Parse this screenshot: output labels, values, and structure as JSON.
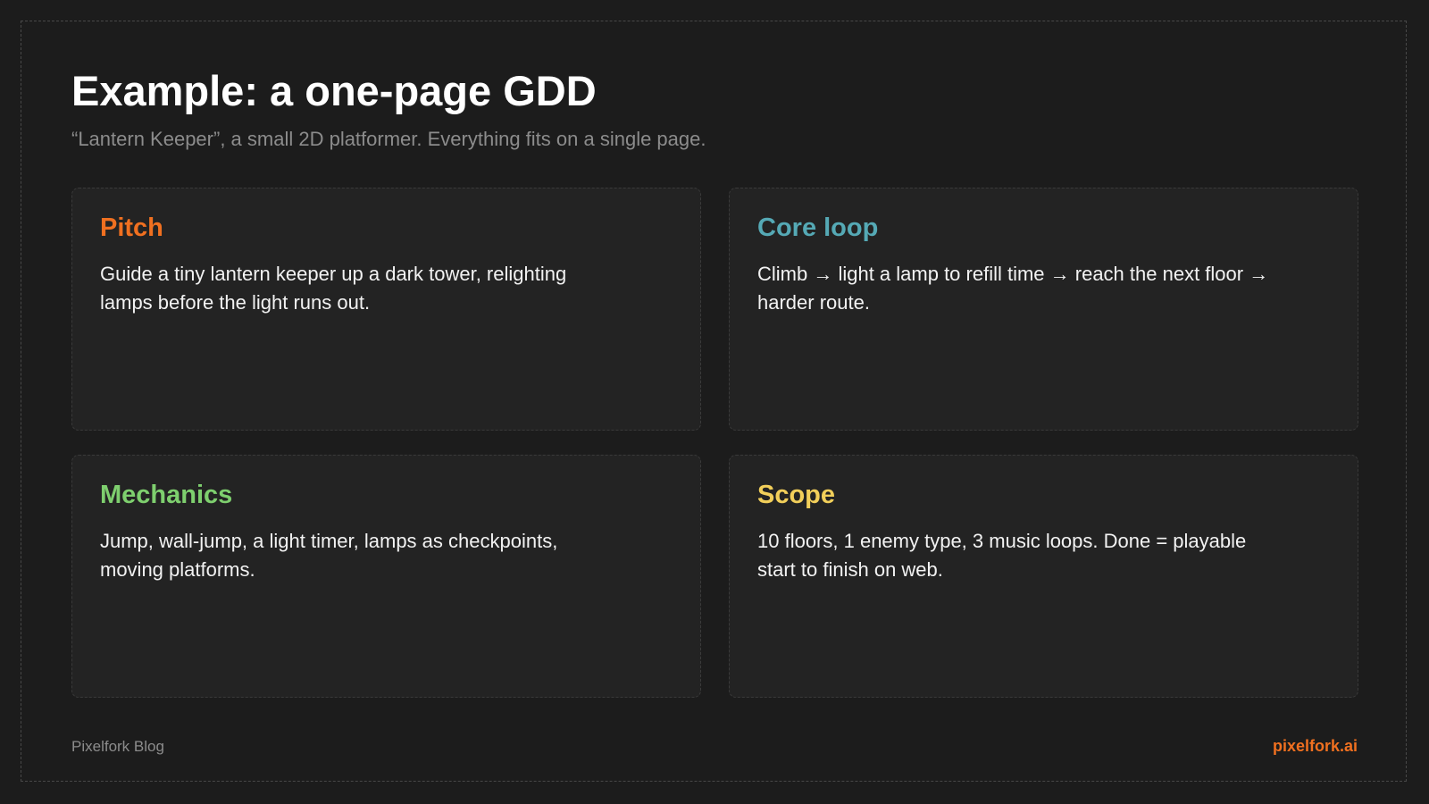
{
  "slide": {
    "title": "Example: a one-page GDD",
    "subtitle": "“Lantern Keeper”, a small 2D platformer. Everything fits on a single page."
  },
  "cards": [
    {
      "title": "Pitch",
      "text": "Guide a tiny lantern keeper up a dark tower, relighting lamps before the light runs out.",
      "color": "#f07020"
    },
    {
      "title": "Core loop",
      "text": "Climb → light a lamp to refill time → reach the next floor → harder route.",
      "color": "#55a9b5"
    },
    {
      "title": "Mechanics",
      "text": "Jump, wall-jump, a light timer, lamps as checkpoints, moving platforms.",
      "color": "#7ecf6e"
    },
    {
      "title": "Scope",
      "text": "10 floors, 1 enemy type, 3 music loops. Done = playable start to finish on web.",
      "color": "#f2cf5a"
    }
  ],
  "footer": {
    "left": "Pixelfork Blog",
    "right": "pixelfork.ai",
    "right_color": "#f07020"
  }
}
